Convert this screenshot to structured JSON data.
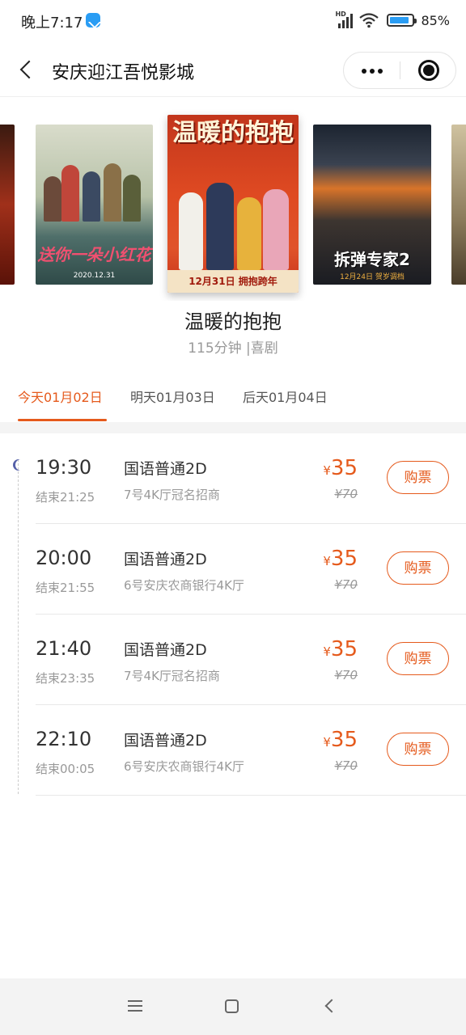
{
  "status_bar": {
    "time": "晚上7:17",
    "network_label": "HD",
    "battery_text": "85%",
    "battery_level": 0.85
  },
  "header": {
    "title": "安庆迎江吾悦影城"
  },
  "posters": [
    {
      "name": "poster-partial-left"
    },
    {
      "name": "poster-movie-2",
      "title_text": "送你一朵小红花",
      "date_text": "2020.12.31"
    },
    {
      "name": "poster-movie-selected",
      "title_text": "温暖的抱抱",
      "banner_text": "12月31日 拥抱跨年"
    },
    {
      "name": "poster-movie-4",
      "title_text": "拆弹专家2",
      "sub_text": "12月24日 贺岁调档"
    },
    {
      "name": "poster-partial-right"
    }
  ],
  "movie": {
    "title": "温暖的抱抱",
    "meta": "115分钟 |喜剧"
  },
  "date_tabs": [
    {
      "label": "今天01月02日",
      "active": true
    },
    {
      "label": "明天01月03日",
      "active": false
    },
    {
      "label": "后天01月04日",
      "active": false
    }
  ],
  "sessions": [
    {
      "time": "19:30",
      "end": "结束21:25",
      "lang": "国语普通2D",
      "hall": "7号4K厅冠名招商",
      "currency": "¥",
      "price": "35",
      "orig_price": "¥70",
      "button": "购票"
    },
    {
      "time": "20:00",
      "end": "结束21:55",
      "lang": "国语普通2D",
      "hall": "6号安庆农商银行4K厅",
      "currency": "¥",
      "price": "35",
      "orig_price": "¥70",
      "button": "购票"
    },
    {
      "time": "21:40",
      "end": "结束23:35",
      "lang": "国语普通2D",
      "hall": "7号4K厅冠名招商",
      "currency": "¥",
      "price": "35",
      "orig_price": "¥70",
      "button": "购票"
    },
    {
      "time": "22:10",
      "end": "结束00:05",
      "lang": "国语普通2D",
      "hall": "6号安庆农商银行4K厅",
      "currency": "¥",
      "price": "35",
      "orig_price": "¥70",
      "button": "购票"
    }
  ],
  "colors": {
    "accent": "#e55a1c",
    "text_primary": "#222222",
    "text_secondary": "#999999",
    "moon": "#5560a8"
  },
  "icons": {
    "back": "chevron-left-icon",
    "more": "more-dots-icon",
    "close": "target-close-icon",
    "night": "moon-icon",
    "nav_menu": "menu-icon",
    "nav_home": "home-square-icon",
    "nav_back": "back-triangle-icon"
  }
}
